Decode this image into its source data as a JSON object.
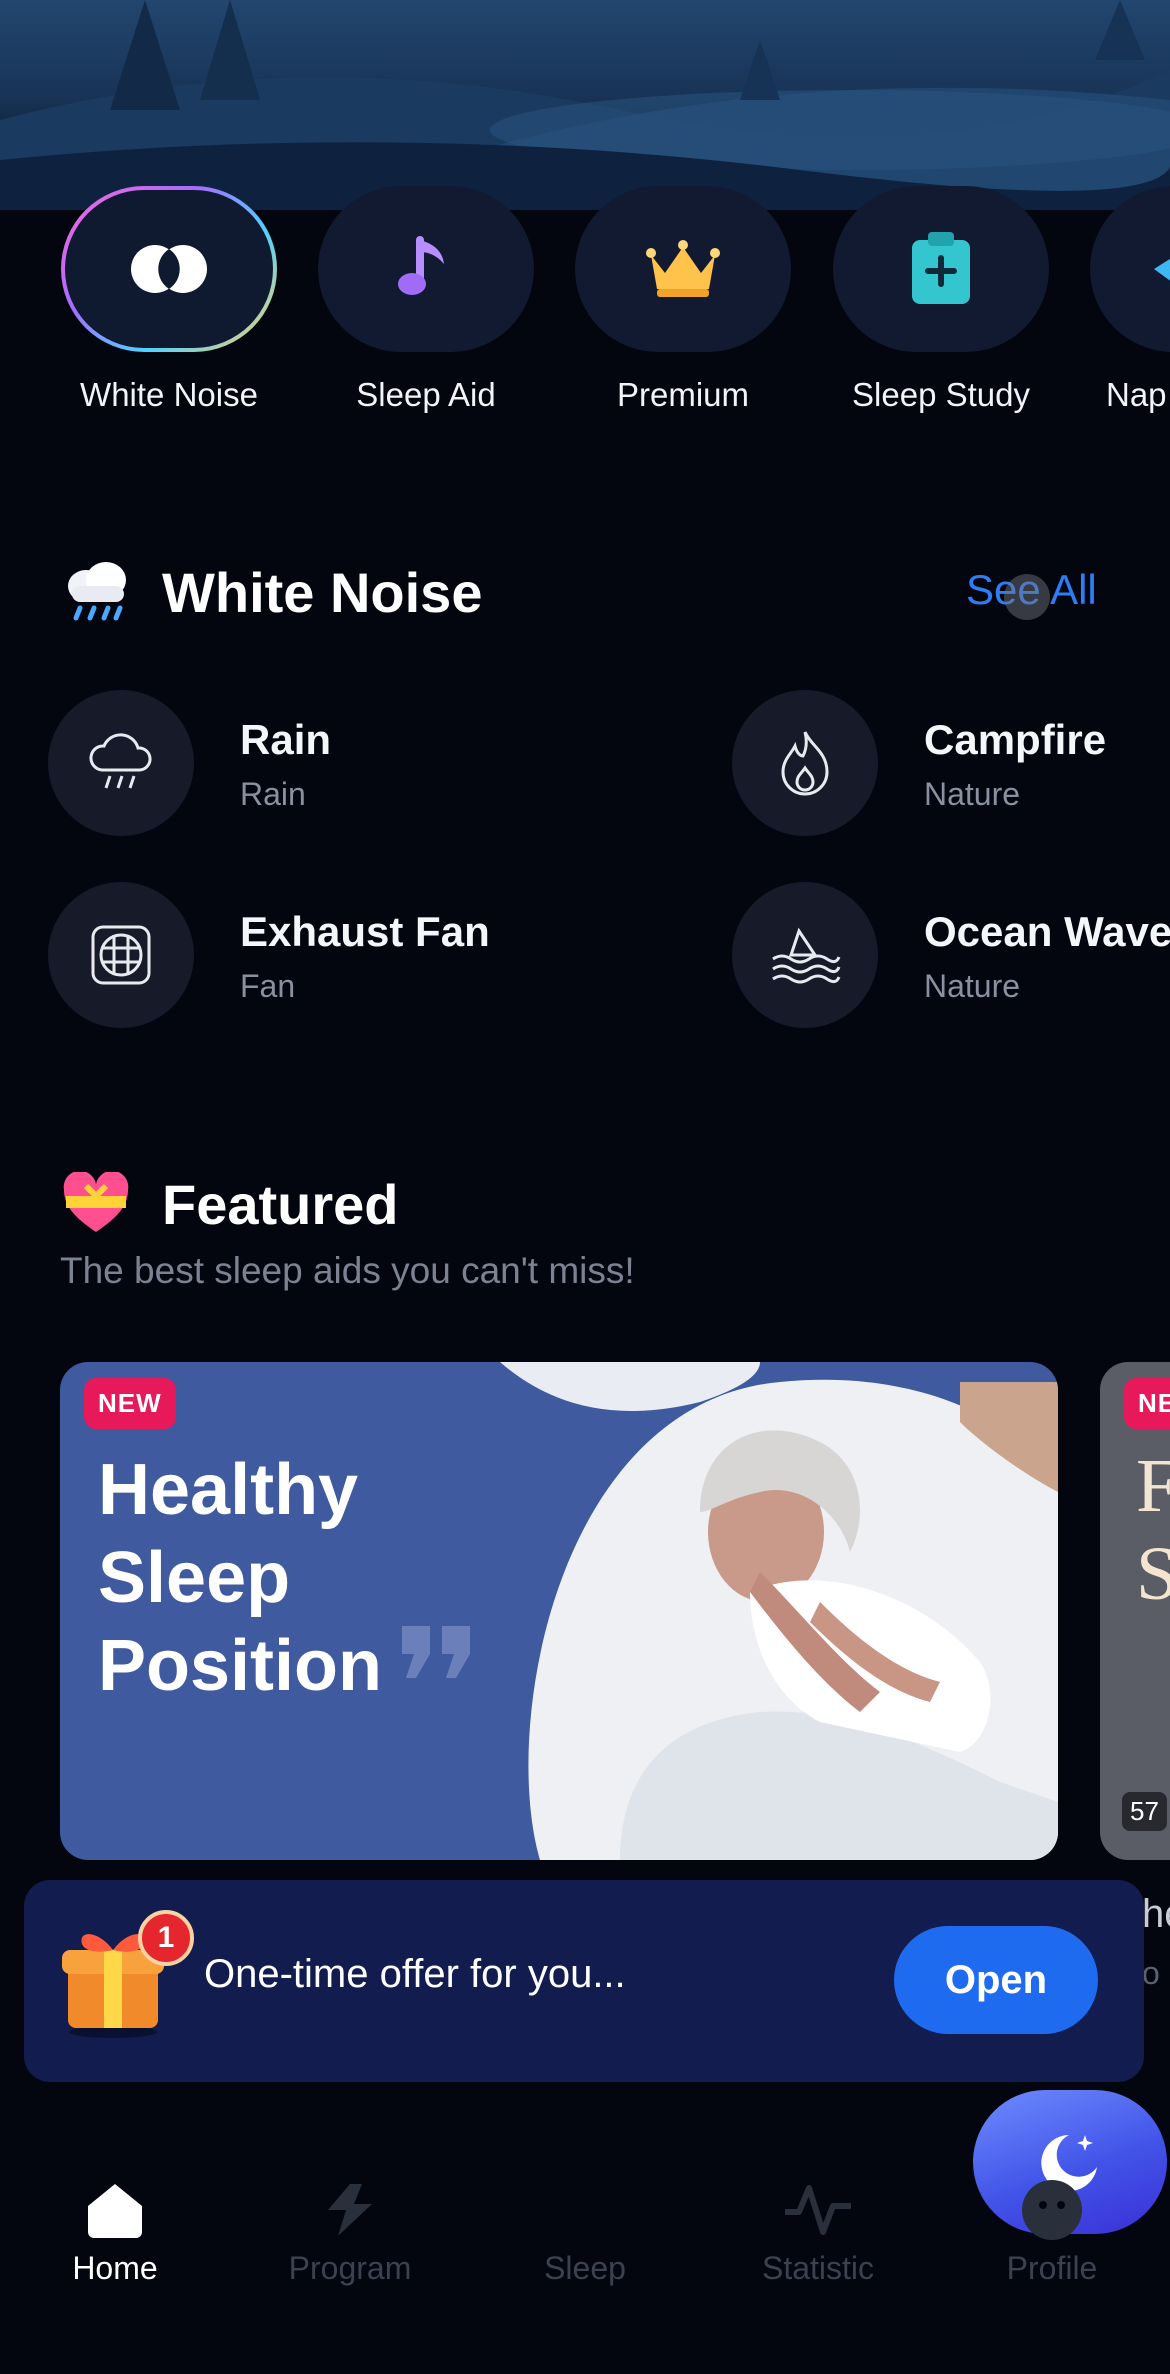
{
  "categories": [
    {
      "label": "White Noise",
      "icon": "white-noise-icon",
      "active": true
    },
    {
      "label": "Sleep Aid",
      "icon": "music-note-icon"
    },
    {
      "label": "Premium",
      "icon": "crown-icon"
    },
    {
      "label": "Sleep Study",
      "icon": "clipboard-icon"
    },
    {
      "label": "Nap",
      "icon": "nap-icon"
    }
  ],
  "white_noise": {
    "title": "White Noise",
    "see_all": "See All",
    "items": [
      {
        "name": "Rain",
        "sub": "Rain",
        "icon": "rain-cloud-icon"
      },
      {
        "name": "Campfire",
        "sub": "Nature",
        "icon": "flame-icon"
      },
      {
        "name": "Exhaust Fan",
        "sub": "Fan",
        "icon": "fan-icon"
      },
      {
        "name": "Ocean Waves",
        "sub": "Nature",
        "icon": "waves-icon"
      }
    ]
  },
  "featured": {
    "title": "Featured",
    "subtitle": "The best sleep aids you can't miss!",
    "cards": [
      {
        "badge": "NEW",
        "title_lines": [
          "Healthy",
          "Sleep",
          "Position"
        ]
      },
      {
        "badge": "NE",
        "title_lines": [
          "F",
          "S"
        ],
        "duration": "57",
        "caption": "he",
        "caption_sub": "o"
      }
    ]
  },
  "offer": {
    "text": "One-time offer for you...",
    "button": "Open",
    "count": "1"
  },
  "tabs": [
    {
      "label": "Home",
      "active": true
    },
    {
      "label": "Program"
    },
    {
      "label": "Sleep"
    },
    {
      "label": "Statistic"
    },
    {
      "label": "Profile"
    }
  ],
  "colors": {
    "accent": "#2f7df6",
    "background": "#03060f",
    "badge": "#e8195a",
    "offer_bg": "#121c4f"
  }
}
